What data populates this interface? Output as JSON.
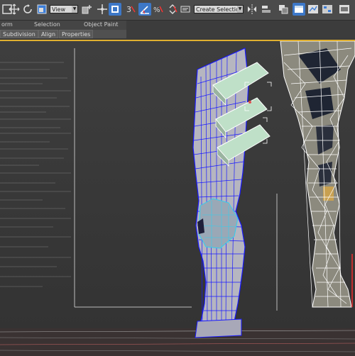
{
  "toolbar": {
    "icons": [
      "select-move-icon",
      "rotate-icon",
      "scale-icon",
      "reference-coord-dropdown",
      "pivot-icon",
      "select-manipulate-icon",
      "snap-3-icon",
      "angle-snap-icon",
      "percent-snap-icon",
      "spinner-snap-icon",
      "named-selection-dropdown",
      "mirror-icon",
      "align-icon",
      "layer-icon",
      "ribbon-icon",
      "curve-editor-icon"
    ],
    "reference_coord": "View",
    "named_selection": "Create Selection S",
    "snap_label": "3"
  },
  "ribbon": {
    "tabs": [
      "orm",
      "Selection",
      "Object Paint"
    ],
    "buttons": [
      "Subdivision",
      "Align",
      "Properties"
    ]
  },
  "colors": {
    "accent_active": "#3d78c8",
    "viewport_border": "#e0b030",
    "wire_blue": "#1a1aff",
    "wire_white": "#ffffff"
  }
}
